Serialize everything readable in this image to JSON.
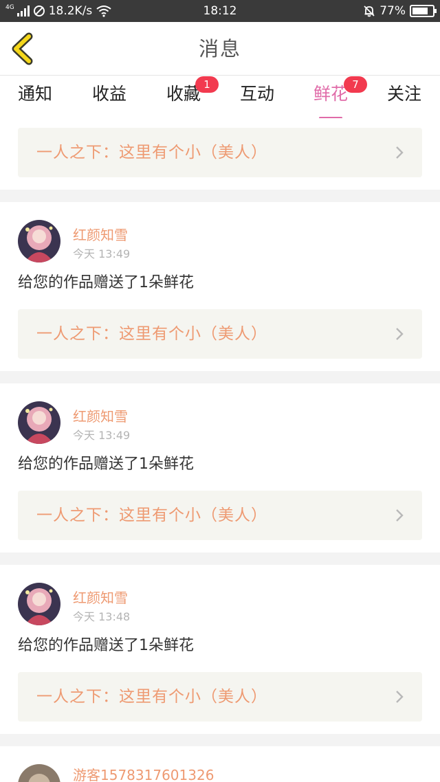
{
  "status_bar": {
    "network": "4G",
    "speed": "18.2K/s",
    "time": "18:12",
    "battery": "77%",
    "battery_level": 0.77,
    "icons": [
      "signal-icon",
      "no-disturb-icon",
      "wifi-icon",
      "alarm-off-icon",
      "battery-icon"
    ]
  },
  "header": {
    "title": "消息",
    "back_icon": "chevron-left-icon"
  },
  "tabs": [
    {
      "label": "通知",
      "badge": null,
      "active": false
    },
    {
      "label": "收益",
      "badge": null,
      "active": false
    },
    {
      "label": "收藏",
      "badge": "1",
      "active": false
    },
    {
      "label": "互动",
      "badge": null,
      "active": false
    },
    {
      "label": "鲜花",
      "badge": "7",
      "active": true
    },
    {
      "label": "关注",
      "badge": null,
      "active": false
    }
  ],
  "top_link": {
    "text": "一人之下：这里有个小（美人）"
  },
  "messages": [
    {
      "user": "红颜知雪",
      "time": "今天 13:49",
      "text": "给您的作品赠送了1朵鲜花",
      "link": "一人之下：这里有个小（美人）"
    },
    {
      "user": "红颜知雪",
      "time": "今天 13:49",
      "text": "给您的作品赠送了1朵鲜花",
      "link": "一人之下：这里有个小（美人）"
    },
    {
      "user": "红颜知雪",
      "time": "今天 13:48",
      "text": "给您的作品赠送了1朵鲜花",
      "link": "一人之下：这里有个小（美人）"
    },
    {
      "user": "游客1578317601326"
    }
  ],
  "colors": {
    "accent_pink": "#e06ba8",
    "name_orange": "#ee9a72",
    "badge_red": "#f23a4f",
    "back_yellow": "#f5d71a"
  }
}
